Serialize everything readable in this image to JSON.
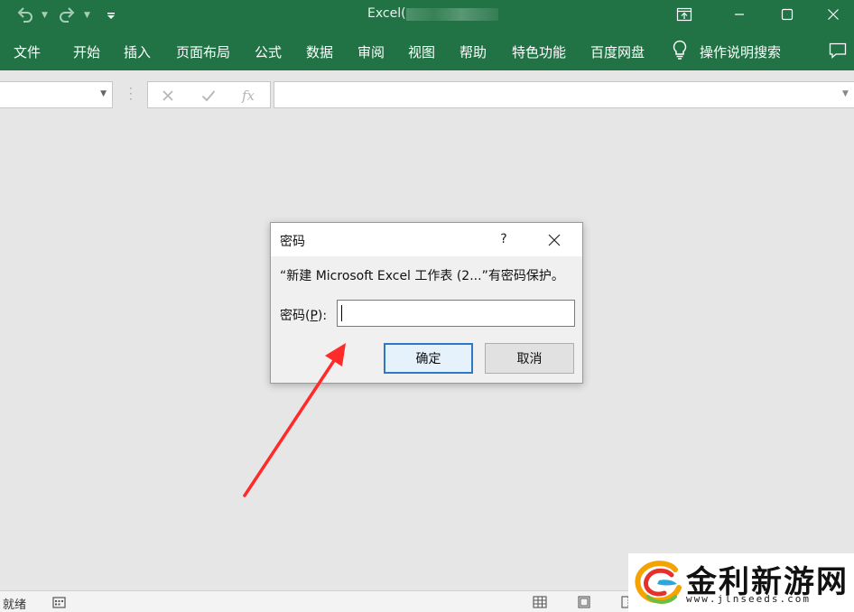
{
  "window": {
    "title": "Excel(",
    "icons": {
      "undo": "undo-icon",
      "redo": "redo-icon",
      "customize": "customize-qat-icon",
      "ribbon_display": "ribbon-display-icon",
      "minimize": "minimize-icon",
      "maximize": "maximize-icon",
      "close": "close-icon"
    }
  },
  "ribbon": {
    "tabs": [
      "文件",
      "开始",
      "插入",
      "页面布局",
      "公式",
      "数据",
      "审阅",
      "视图",
      "帮助",
      "特色功能",
      "百度网盘"
    ],
    "tell_me": "操作说明搜索",
    "tell_me_icon": "lightbulb-icon",
    "comment_icon": "comment-icon"
  },
  "formula_bar": {
    "name_box_value": "",
    "cancel_icon": "cancel-x-icon",
    "enter_icon": "checkmark-icon",
    "function_label": "fx",
    "formula_value": ""
  },
  "dialog": {
    "title": "密码",
    "help_label": "?",
    "message": "“新建 Microsoft Excel 工作表 (2...”有密码保护。",
    "password_label_prefix": "密码(",
    "password_label_key": "P",
    "password_label_suffix": "):",
    "password_value": "",
    "ok_label": "确定",
    "cancel_label": "取消"
  },
  "status_bar": {
    "status_text": "就绪",
    "icons": [
      "macro-record-icon",
      "normal-view-icon",
      "page-layout-view-icon",
      "page-break-view-icon"
    ]
  },
  "watermark": {
    "name": "金利新游网",
    "url": "www.jlnseeds.com"
  },
  "colors": {
    "excel_green": "#217346",
    "arrow_red": "#ff2a2a",
    "ok_border": "#2b78c6"
  }
}
